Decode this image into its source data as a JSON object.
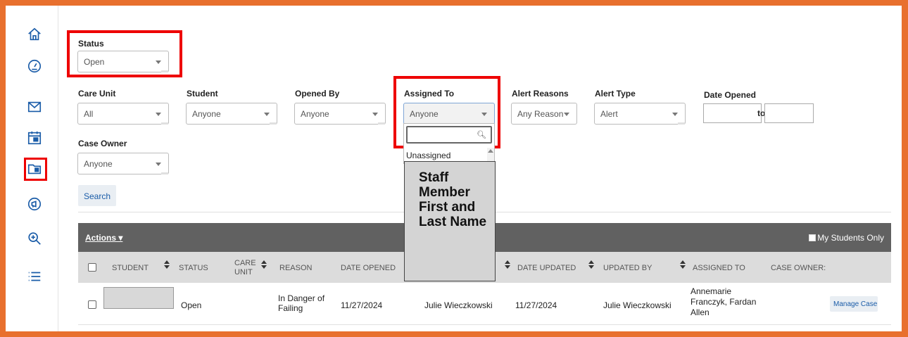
{
  "sidebar": {
    "items": [
      {
        "icon": "home-icon"
      },
      {
        "icon": "dashboard-gauge-icon"
      },
      {
        "icon": "mail-icon"
      },
      {
        "icon": "calendar-icon"
      },
      {
        "icon": "case-folder-icon",
        "highlighted": true
      },
      {
        "icon": "megaphone-icon"
      },
      {
        "icon": "zoom-in-icon"
      },
      {
        "icon": "list-icon"
      }
    ]
  },
  "filters": {
    "status": {
      "label": "Status",
      "value": "Open"
    },
    "care_unit": {
      "label": "Care Unit",
      "value": "All"
    },
    "student": {
      "label": "Student",
      "value": "Anyone"
    },
    "opened_by": {
      "label": "Opened By",
      "value": "Anyone"
    },
    "assigned_to": {
      "label": "Assigned To",
      "value": "Anyone"
    },
    "alert_reasons": {
      "label": "Alert Reasons",
      "value": "Any Reason"
    },
    "alert_type": {
      "label": "Alert Type",
      "value": "Alert"
    },
    "date_opened": {
      "label": "Date Opened",
      "separator": "to",
      "from": "",
      "to": ""
    },
    "case_owner": {
      "label": "Case Owner",
      "value": "Anyone"
    }
  },
  "search_button": "Search",
  "assigned_dropdown": {
    "search_value": "",
    "items": [
      "Unassigned"
    ]
  },
  "callout": "Staff Member First and Last Name",
  "table": {
    "actions_label": "Actions ▾",
    "my_students_label": "My Students Only",
    "columns": {
      "student": "STUDENT",
      "status": "STATUS",
      "care_unit": "CARE UNIT",
      "reason": "REASON",
      "date_opened": "DATE OPENED",
      "date_updated": "DATE UPDATED",
      "updated_by": "UPDATED BY",
      "assigned_to": "ASSIGNED TO",
      "case_owner": "CASE OWNER:"
    },
    "rows": [
      {
        "student": "",
        "status": "Open",
        "care_unit": "",
        "reason": "In Danger of Failing",
        "date_opened": "11/27/2024",
        "opened_by": "Julie Wieczkowski",
        "date_updated": "11/27/2024",
        "updated_by": "Julie Wieczkowski",
        "assigned_to": "Annemarie Franczyk, Fardan Allen",
        "case_owner": "",
        "action": "Manage Case"
      }
    ]
  },
  "colors": {
    "frame": "#e8702e",
    "highlight": "#ee0000",
    "bar": "#616161",
    "header": "#dcdcdc",
    "link": "#1a5ca8"
  }
}
